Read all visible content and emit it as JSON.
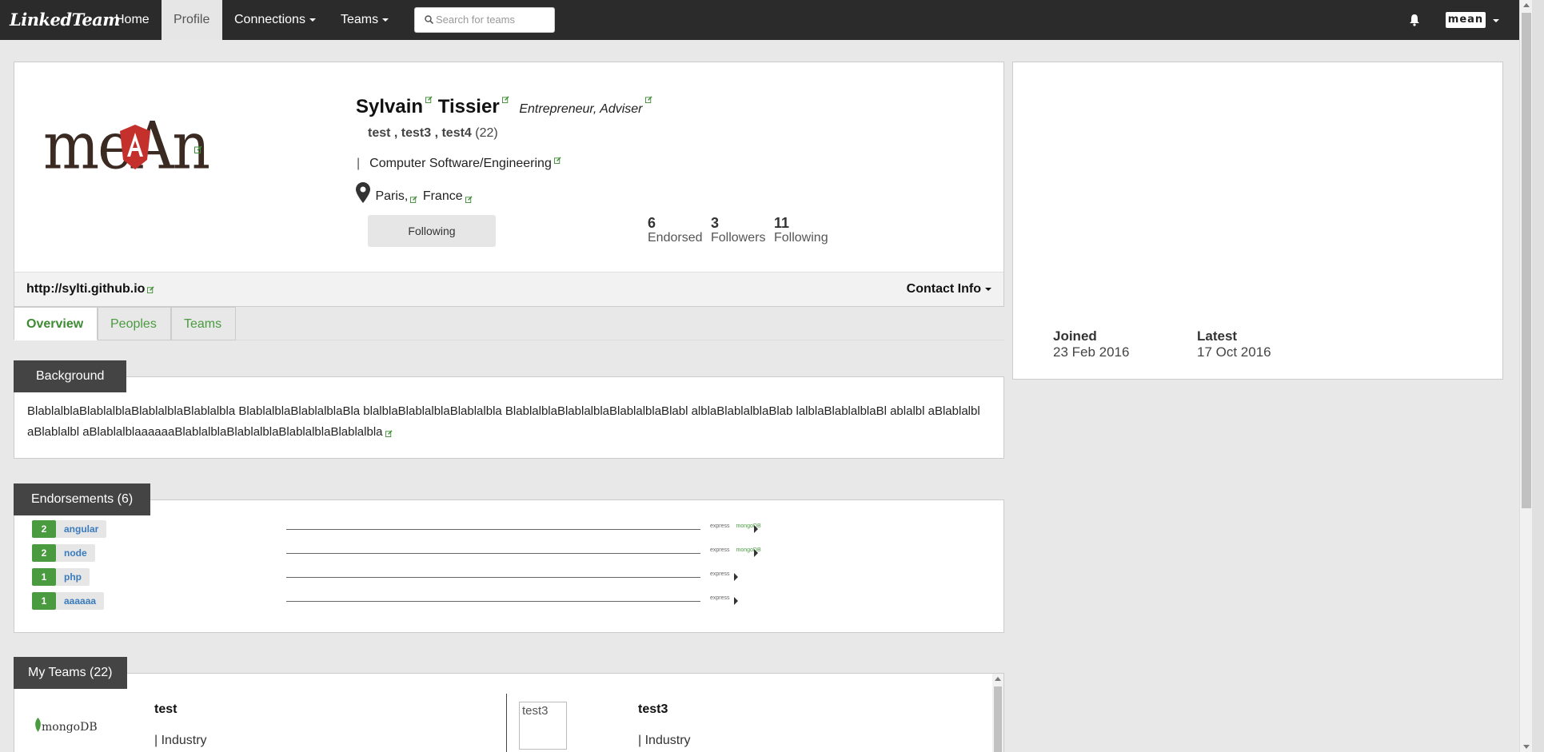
{
  "nav": {
    "brand": "LinkedTeam",
    "home": "Home",
    "profile": "Profile",
    "connections": "Connections",
    "teams": "Teams",
    "search_placeholder": "Search for teams",
    "user_logo": "mean"
  },
  "profile": {
    "logo_text": "meAn",
    "first_name": "Sylvain",
    "last_name": "Tissier",
    "headline": "Entrepreneur, Adviser",
    "teams": "test , test3 , test4",
    "teams_count": "(22)",
    "industry_sep": "|",
    "industry": "Computer Software/Engineering",
    "city": "Paris,",
    "country": "France",
    "follow_button": "Following",
    "stats": [
      {
        "num": "6",
        "label": "Endorsed"
      },
      {
        "num": "3",
        "label": "Followers"
      },
      {
        "num": "11",
        "label": "Following"
      }
    ],
    "url": "http://sylti.github.io",
    "contact_info": "Contact Info"
  },
  "tabs": [
    "Overview",
    "Peoples",
    "Teams"
  ],
  "background": {
    "title": "Background",
    "text": "BlablalblaBlablalblaBlablalblaBlablalbla BlablalblaBlablalblaBla blalblaBlablalblaBlablalbla BlablalblaBlablalblaBlablalblaBlabl alblaBlablalblaBlab lalblaBlablalblaBl ablalbl aBlablalbl aBlablalbl aBlablalblaaaaaaBlablalblaBlablalblaBlablalblaBlablalbla"
  },
  "endorsements": {
    "title": "Endorsements (6)",
    "items": [
      {
        "count": "2",
        "skill": "angular",
        "thumbs": [
          "express",
          "mongoDB"
        ]
      },
      {
        "count": "2",
        "skill": "node",
        "thumbs": [
          "express",
          "mongoDB"
        ]
      },
      {
        "count": "1",
        "skill": "php",
        "thumbs": [
          "express"
        ]
      },
      {
        "count": "1",
        "skill": "aaaaaa",
        "thumbs": [
          "express"
        ]
      }
    ]
  },
  "my_teams": {
    "title": "My Teams (22)",
    "teams": [
      {
        "logo": "mongoDB",
        "name": "test",
        "industry": "| Industry"
      },
      {
        "logo": "test3",
        "name": "test3",
        "industry": "| Industry"
      }
    ]
  },
  "side": {
    "joined_label": "Joined",
    "joined_value": "23 Feb 2016",
    "latest_label": "Latest",
    "latest_value": "17 Oct 2016"
  },
  "colors": {
    "accent": "#4a9a3f",
    "nav_bg": "#2b2b2b",
    "section_bg": "#444444"
  }
}
